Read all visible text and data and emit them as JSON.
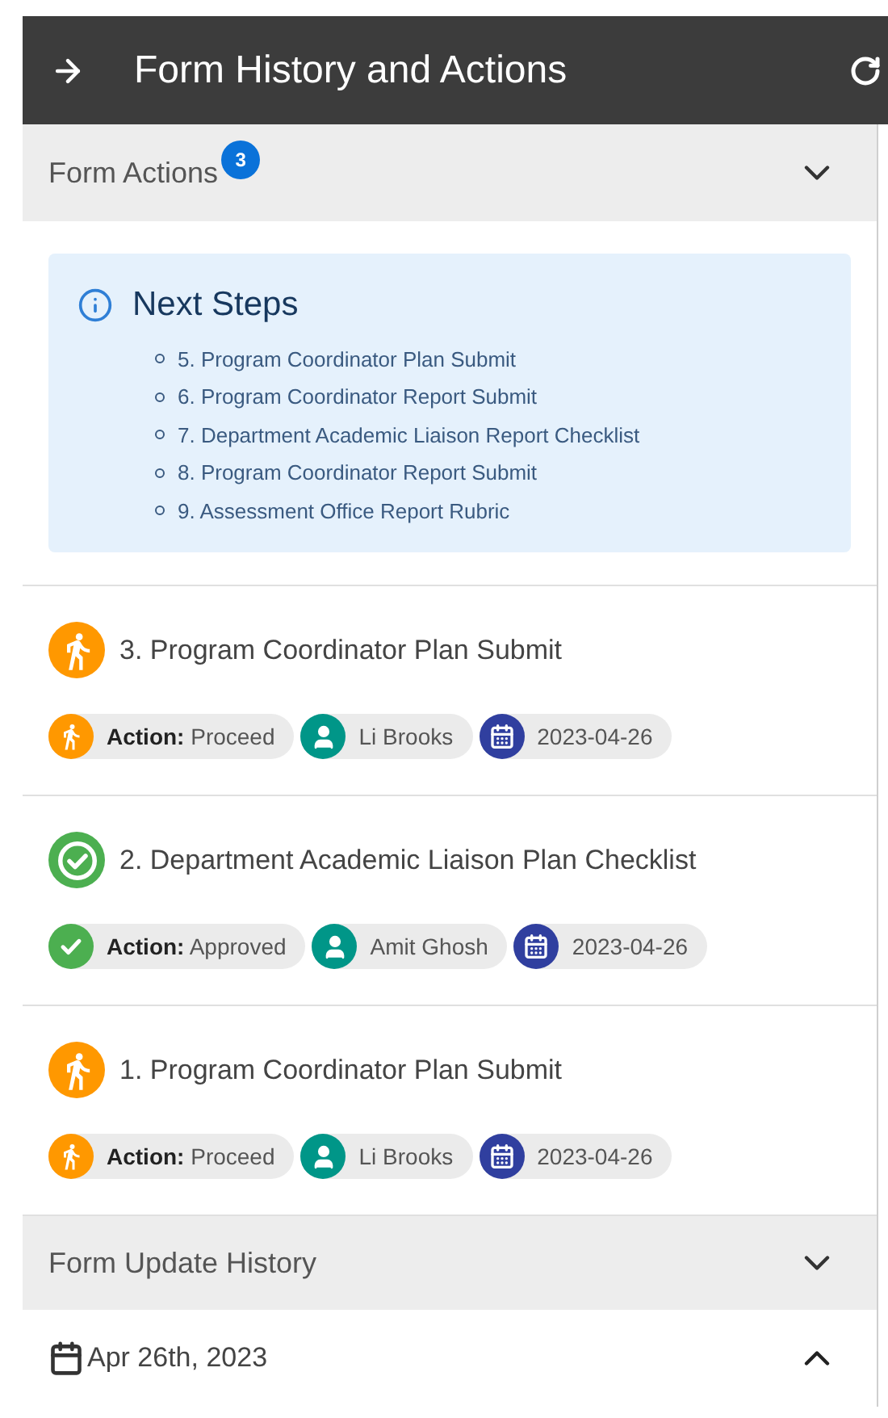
{
  "header": {
    "title": "Form History and Actions"
  },
  "form_actions": {
    "title": "Form Actions",
    "badge": "3",
    "next_steps": {
      "title": "Next Steps",
      "items": [
        "5. Program Coordinator Plan Submit",
        "6. Program Coordinator Report Submit",
        "7. Department Academic Liaison Report Checklist",
        "8. Program Coordinator Report Submit",
        "9. Assessment Office Report Rubric"
      ]
    },
    "entries": [
      {
        "kind": "proceed",
        "title": "3. Program Coordinator Plan Submit",
        "action_label": "Action:",
        "action": "Proceed",
        "person": "Li Brooks",
        "date": "2023-04-26"
      },
      {
        "kind": "approved",
        "title": "2. Department Academic Liaison Plan Checklist",
        "action_label": "Action:",
        "action": "Approved",
        "person": "Amit Ghosh",
        "date": "2023-04-26"
      },
      {
        "kind": "proceed",
        "title": "1. Program Coordinator Plan Submit",
        "action_label": "Action:",
        "action": "Proceed",
        "person": "Li Brooks",
        "date": "2023-04-26"
      }
    ]
  },
  "update_history": {
    "title": "Form Update History",
    "groups": [
      {
        "date": "Apr 26th, 2023"
      }
    ]
  }
}
